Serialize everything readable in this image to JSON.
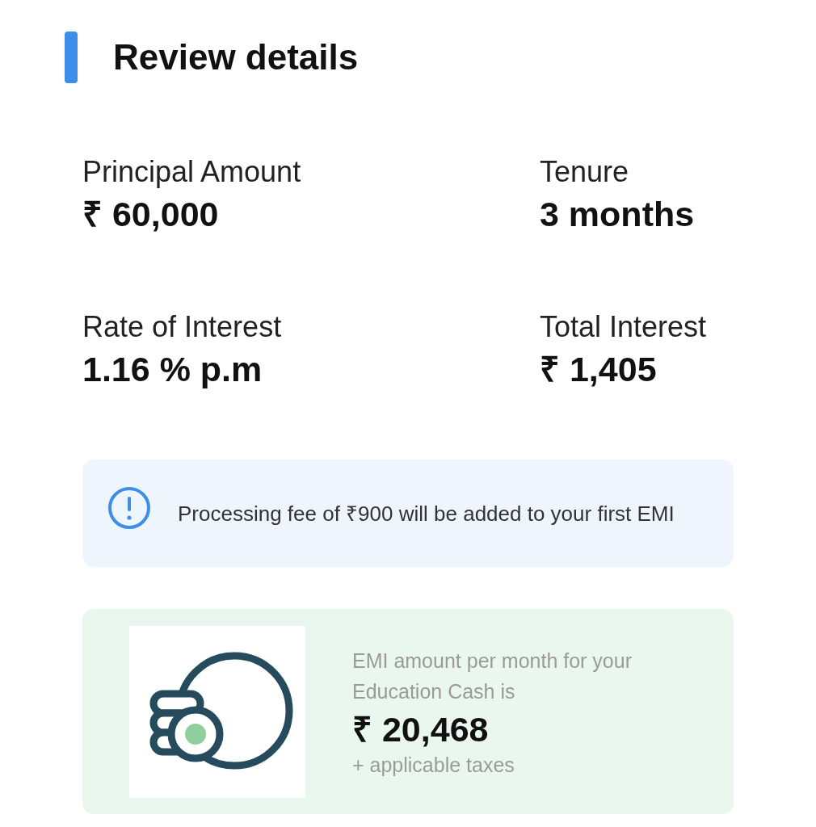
{
  "section": {
    "title": "Review details"
  },
  "details": [
    {
      "label": "Principal Amount",
      "value": "₹ 60,000"
    },
    {
      "label": "Tenure",
      "value": "3 months"
    },
    {
      "label": "Rate of Interest",
      "value": "1.16 % p.m"
    },
    {
      "label": "Total Interest",
      "value": "₹ 1,405"
    }
  ],
  "notice": {
    "text": "Processing fee of ₹900 will be added to your first EMI"
  },
  "emi": {
    "caption": "EMI amount per month for your Education Cash is",
    "amount": "₹ 20,468",
    "note": "+ applicable taxes"
  }
}
